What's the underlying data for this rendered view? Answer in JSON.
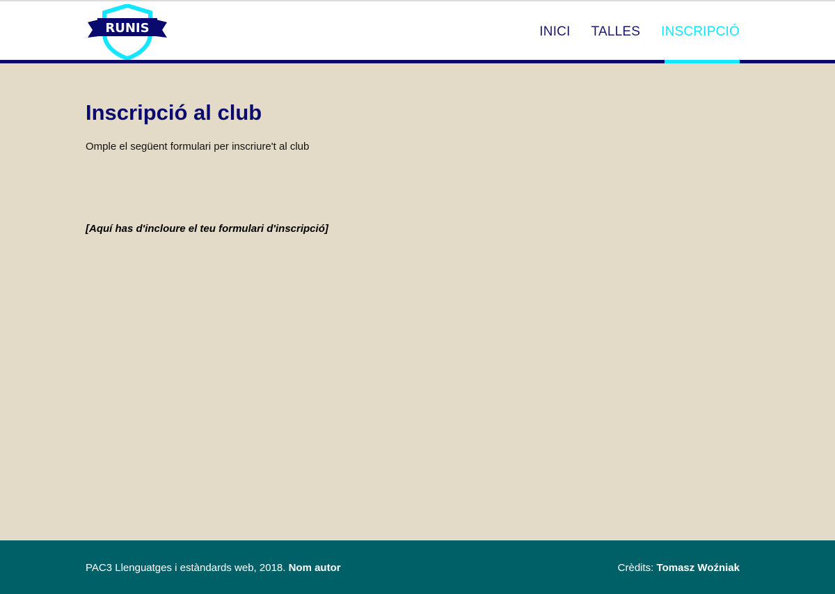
{
  "header": {
    "logo": {
      "text": "RUNIS",
      "icon": "shield-banner-logo",
      "colors": {
        "shield": "#14e6ff",
        "banner": "#0a0a6e"
      }
    },
    "nav": [
      {
        "label": "INICI",
        "active": false
      },
      {
        "label": "TALLES",
        "active": false
      },
      {
        "label": "INSCRIPCIÓ",
        "active": true
      }
    ]
  },
  "main": {
    "title": "Inscripció al club",
    "intro": "Omple el següent formulari per inscriure't al club",
    "form_placeholder": "[Aquí has d'incloure el teu formulari d'inscripció]"
  },
  "footer": {
    "left_text": "PAC3 Llenguatges i estàndards web, 2018.",
    "left_author": "Nom autor",
    "right_label": "Crèdits:",
    "right_author": "Tomasz Woźniak"
  },
  "colors": {
    "primary": "#0a0a6e",
    "accent": "#14e6ff",
    "background": "#e3dbc7",
    "footer": "#006068"
  }
}
